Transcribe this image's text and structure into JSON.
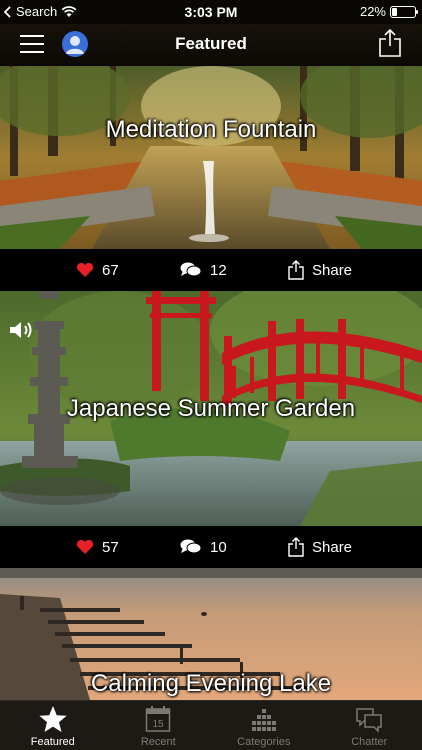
{
  "status": {
    "carrier": "Search",
    "time": "3:03 PM",
    "battery": "22%",
    "battery_level": 0.22
  },
  "nav": {
    "title": "Featured"
  },
  "cards": [
    {
      "title": "Meditation Fountain",
      "likes": "67",
      "comments": "12",
      "share_label": "Share"
    },
    {
      "title": "Japanese Summer Garden",
      "likes": "57",
      "comments": "10",
      "share_label": "Share"
    },
    {
      "title": "Calming Evening Lake"
    }
  ],
  "tabs": [
    {
      "label": "Featured",
      "icon": "star-icon",
      "active": true
    },
    {
      "label": "Recent",
      "icon": "calendar-icon",
      "badge": "15",
      "active": false
    },
    {
      "label": "Categories",
      "icon": "grid-icon",
      "active": false
    },
    {
      "label": "Chatter",
      "icon": "chat-bubbles-icon",
      "active": false
    }
  ],
  "colors": {
    "heart": "#e8202a",
    "active_tab": "#ffffff",
    "inactive_tab": "#7b7974",
    "bridge_red": "#c8181e"
  }
}
